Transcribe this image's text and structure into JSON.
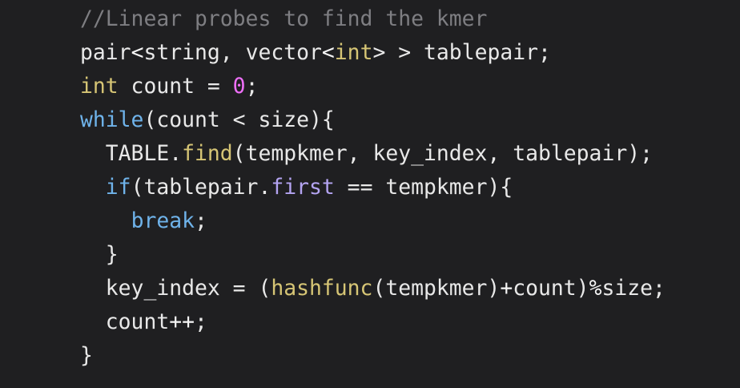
{
  "code_lines": [
    [
      {
        "t": "//Linear probes to find the kmer",
        "c": "comment"
      }
    ],
    [
      {
        "t": "pair",
        "c": "plain"
      },
      {
        "t": "<",
        "c": "op"
      },
      {
        "t": "string",
        "c": "plain"
      },
      {
        "t": ", vector",
        "c": "plain"
      },
      {
        "t": "<",
        "c": "op"
      },
      {
        "t": "int",
        "c": "type"
      },
      {
        "t": "> > tablepair;",
        "c": "plain"
      }
    ],
    [
      {
        "t": "int",
        "c": "type"
      },
      {
        "t": " count = ",
        "c": "plain"
      },
      {
        "t": "0",
        "c": "number"
      },
      {
        "t": ";",
        "c": "plain"
      }
    ],
    [
      {
        "t": "while",
        "c": "keyword"
      },
      {
        "t": "(count < size){",
        "c": "plain"
      }
    ],
    [
      {
        "t": "  TABLE.",
        "c": "plain"
      },
      {
        "t": "find",
        "c": "func"
      },
      {
        "t": "(tempkmer, key_index, tablepair);",
        "c": "plain"
      }
    ],
    [
      {
        "t": "  ",
        "c": "plain"
      },
      {
        "t": "if",
        "c": "keyword"
      },
      {
        "t": "(tablepair.",
        "c": "plain"
      },
      {
        "t": "first",
        "c": "prop"
      },
      {
        "t": " == tempkmer){",
        "c": "plain"
      }
    ],
    [
      {
        "t": "    ",
        "c": "plain"
      },
      {
        "t": "break",
        "c": "keyword"
      },
      {
        "t": ";",
        "c": "plain"
      }
    ],
    [
      {
        "t": "  }",
        "c": "plain"
      }
    ],
    [
      {
        "t": "  key_index = (",
        "c": "plain"
      },
      {
        "t": "hashfunc",
        "c": "func"
      },
      {
        "t": "(tempkmer)",
        "c": "plain"
      },
      {
        "t": "+",
        "c": "op"
      },
      {
        "t": "count)",
        "c": "plain"
      },
      {
        "t": "%",
        "c": "op"
      },
      {
        "t": "size;",
        "c": "plain"
      }
    ],
    [
      {
        "t": "  count",
        "c": "plain"
      },
      {
        "t": "++",
        "c": "op"
      },
      {
        "t": ";",
        "c": "plain"
      }
    ],
    [
      {
        "t": "}",
        "c": "plain"
      }
    ]
  ],
  "colors": {
    "background": "#1f1f21",
    "comment": "#7e7e82",
    "plain": "#e8e8e8",
    "type": "#d6c575",
    "number": "#ee6ff8",
    "keyword": "#6fb3ea",
    "func": "#d6c575",
    "prop": "#b4a4f2"
  }
}
